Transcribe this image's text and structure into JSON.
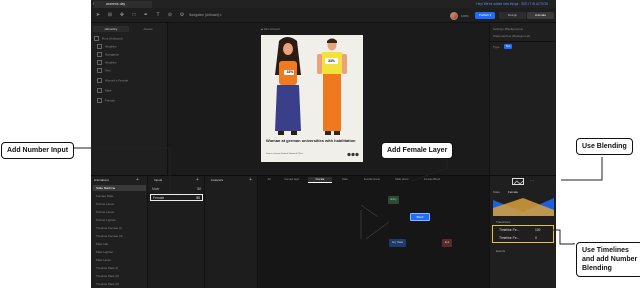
{
  "window": {
    "tab_title": "womens day",
    "top_right_text": "Hey! We've added new things · SEE IT IN ACTION"
  },
  "toolbar": {
    "doc_name": "Navigation (Artboard) ▾",
    "zoom": "100%",
    "publish_label": "Publish ▾",
    "design_label": "Design",
    "animate_label": "Animate"
  },
  "hierarchy": {
    "tabs": [
      "Hierarchy",
      "Assets"
    ],
    "items": [
      "Root (Artboard)",
      "Headline",
      "Navigation",
      "Headline",
      "Text",
      "Women's Female",
      "Male",
      "Female"
    ]
  },
  "canvas": {
    "artboard_label": "◆ Main Artboard",
    "headline": "Woman at german universities with habilitation",
    "badge_left": "33%",
    "badge_right": "33%",
    "credit": "Source: German Federal Statistical Office"
  },
  "right_panel": {
    "rows": [
      "Settings (Background)",
      "Statemachine (Background)",
      "Type"
    ],
    "type_badge": "Text"
  },
  "animations": {
    "header": "Animations",
    "items": [
      "State Machine",
      "Female Male",
      "Pointer Hover",
      "Pointer Hover",
      "Pointer Lighten",
      "Timeline Female (I)",
      "Timeline Female (II)",
      "Male Idle",
      "Male Lighten",
      "Male Hover",
      "Timeline Male (I)",
      "Timeline Male (II)"
    ]
  },
  "inputs": {
    "header": "Inputs",
    "rows": [
      {
        "name": "Male",
        "value": "50"
      },
      {
        "name": "Female",
        "value": "50"
      }
    ]
  },
  "listeners": {
    "header": "Listeners"
  },
  "graph": {
    "layer_tabs": [
      "All",
      "Female layer",
      "Female",
      "Male",
      "Female Hover",
      "Male Hover",
      "Female Blend"
    ],
    "nodes": [
      "Entry",
      "Blend",
      "Any State",
      "Exit"
    ]
  },
  "blend_panel": {
    "state_label": "State",
    "state_value": "Female",
    "section_label": "Transitions",
    "timelines": [
      {
        "name": "Timeline Fe...",
        "value": "100"
      },
      {
        "name": "Timeline Fe...",
        "value": "0"
      }
    ],
    "events_label": "Events"
  },
  "callouts": {
    "number_input": "Add Number Input",
    "female_layer": "Add Female Layer",
    "blending": "Use Blending",
    "timelines": "Use Timelines\nand add Number\nBlending"
  },
  "colors": {
    "accent_blue": "#1f6bff",
    "orange": "#ff7a00",
    "navy_node": "#1d3b6a",
    "red_node": "#5a2a26",
    "green_node": "#2a4a36"
  }
}
